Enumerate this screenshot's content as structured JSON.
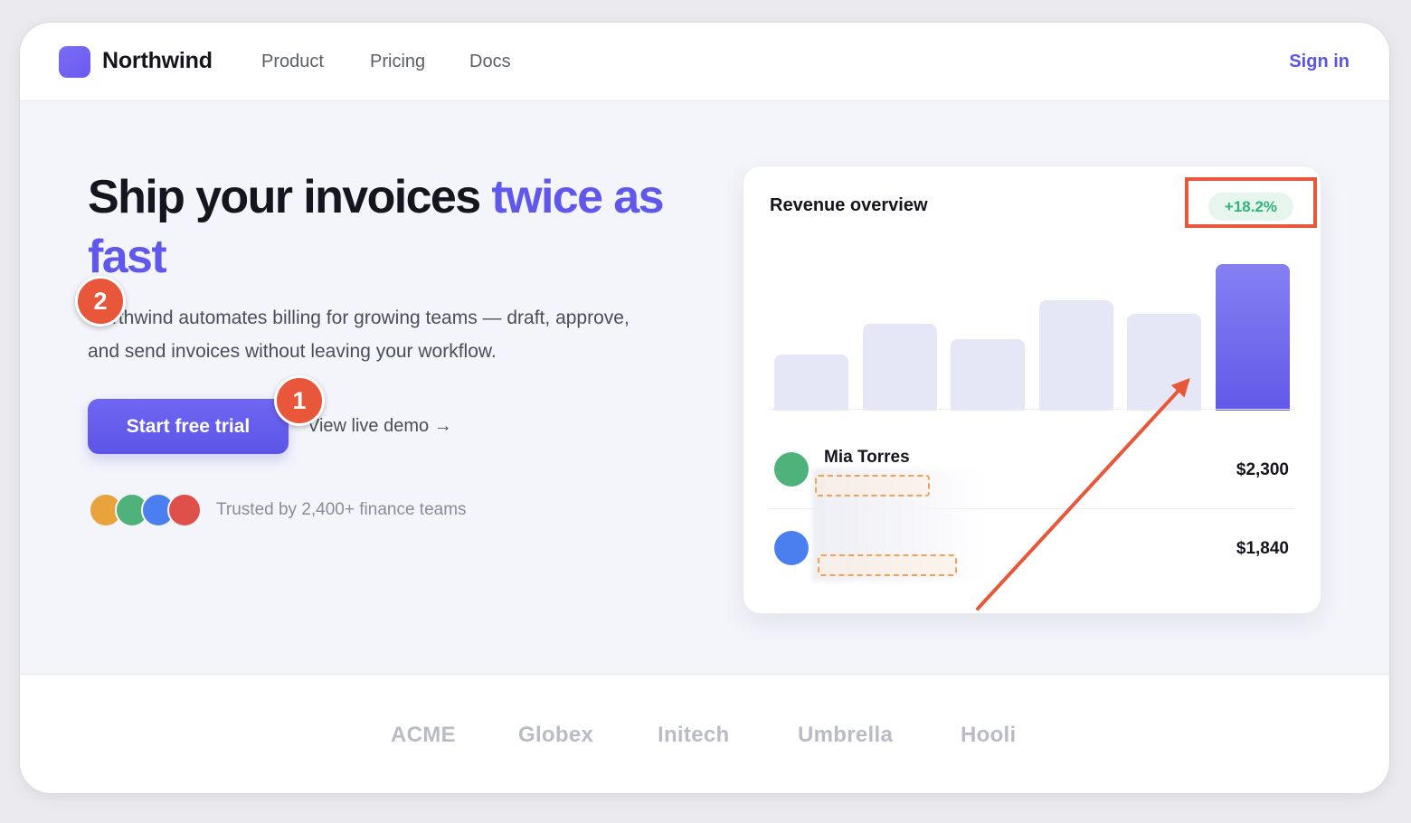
{
  "nav": {
    "brand": "Northwind",
    "links": [
      "Product",
      "Pricing",
      "Docs"
    ],
    "sign_in": "Sign in"
  },
  "hero": {
    "headline_main": "Ship your invoices ",
    "headline_accent": "twice as fast",
    "subtext": "Northwind automates billing for growing teams — draft, approve, and send invoices without leaving your workflow.",
    "cta_label": "Start free trial",
    "demo_label": "View live demo →",
    "trusted_text": "Trusted by 2,400+ finance teams",
    "avatar_colors": [
      "#e8a33a",
      "#4fb27a",
      "#4b7ff0",
      "#e0504a"
    ]
  },
  "card": {
    "title": "Revenue overview",
    "growth_badge": "+18.2%",
    "bar_levels": [
      0.38,
      0.59,
      0.49,
      0.75,
      0.66,
      1.0
    ],
    "rows": [
      {
        "name": "Mia Torres",
        "amount": "$2,300",
        "dot_color": "#4fb27a"
      },
      {
        "name": "",
        "amount": "$1,840",
        "dot_color": "#4b7ff0"
      }
    ]
  },
  "annotations": {
    "marker_1": "1",
    "marker_2": "2",
    "accent_color": "#e9573a"
  },
  "logos": [
    "ACME",
    "Globex",
    "Initech",
    "Umbrella",
    "Hooli"
  ],
  "colors": {
    "brand_accent": "#5f58ea",
    "badge_green": "#33b27a"
  }
}
